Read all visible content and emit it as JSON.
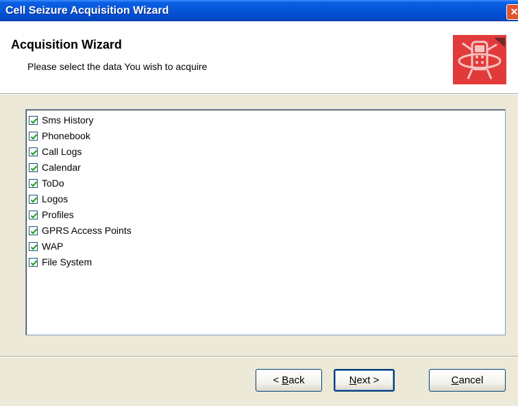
{
  "window": {
    "title": "Cell Seizure Acquisition Wizard",
    "close_glyph": "✕"
  },
  "header": {
    "title": "Acquisition Wizard",
    "subtitle": "Please select the data You wish to acquire",
    "logo_icon": "phone-robot-logo-icon",
    "logo_color": "#e23a3a"
  },
  "items": [
    {
      "label": "Sms History",
      "checked": true
    },
    {
      "label": "Phonebook",
      "checked": true
    },
    {
      "label": "Call Logs",
      "checked": true
    },
    {
      "label": "Calendar",
      "checked": true
    },
    {
      "label": "ToDo",
      "checked": true
    },
    {
      "label": "Logos",
      "checked": true
    },
    {
      "label": "Profiles",
      "checked": true
    },
    {
      "label": "GPRS Access Points",
      "checked": true
    },
    {
      "label": "WAP",
      "checked": true
    },
    {
      "label": "File System",
      "checked": true
    }
  ],
  "buttons": {
    "back": {
      "prefix": "< ",
      "mnemonic": "B",
      "rest": "ack"
    },
    "next": {
      "mnemonic": "N",
      "rest": "ext >"
    },
    "cancel": {
      "mnemonic": "C",
      "rest": "ancel"
    }
  }
}
